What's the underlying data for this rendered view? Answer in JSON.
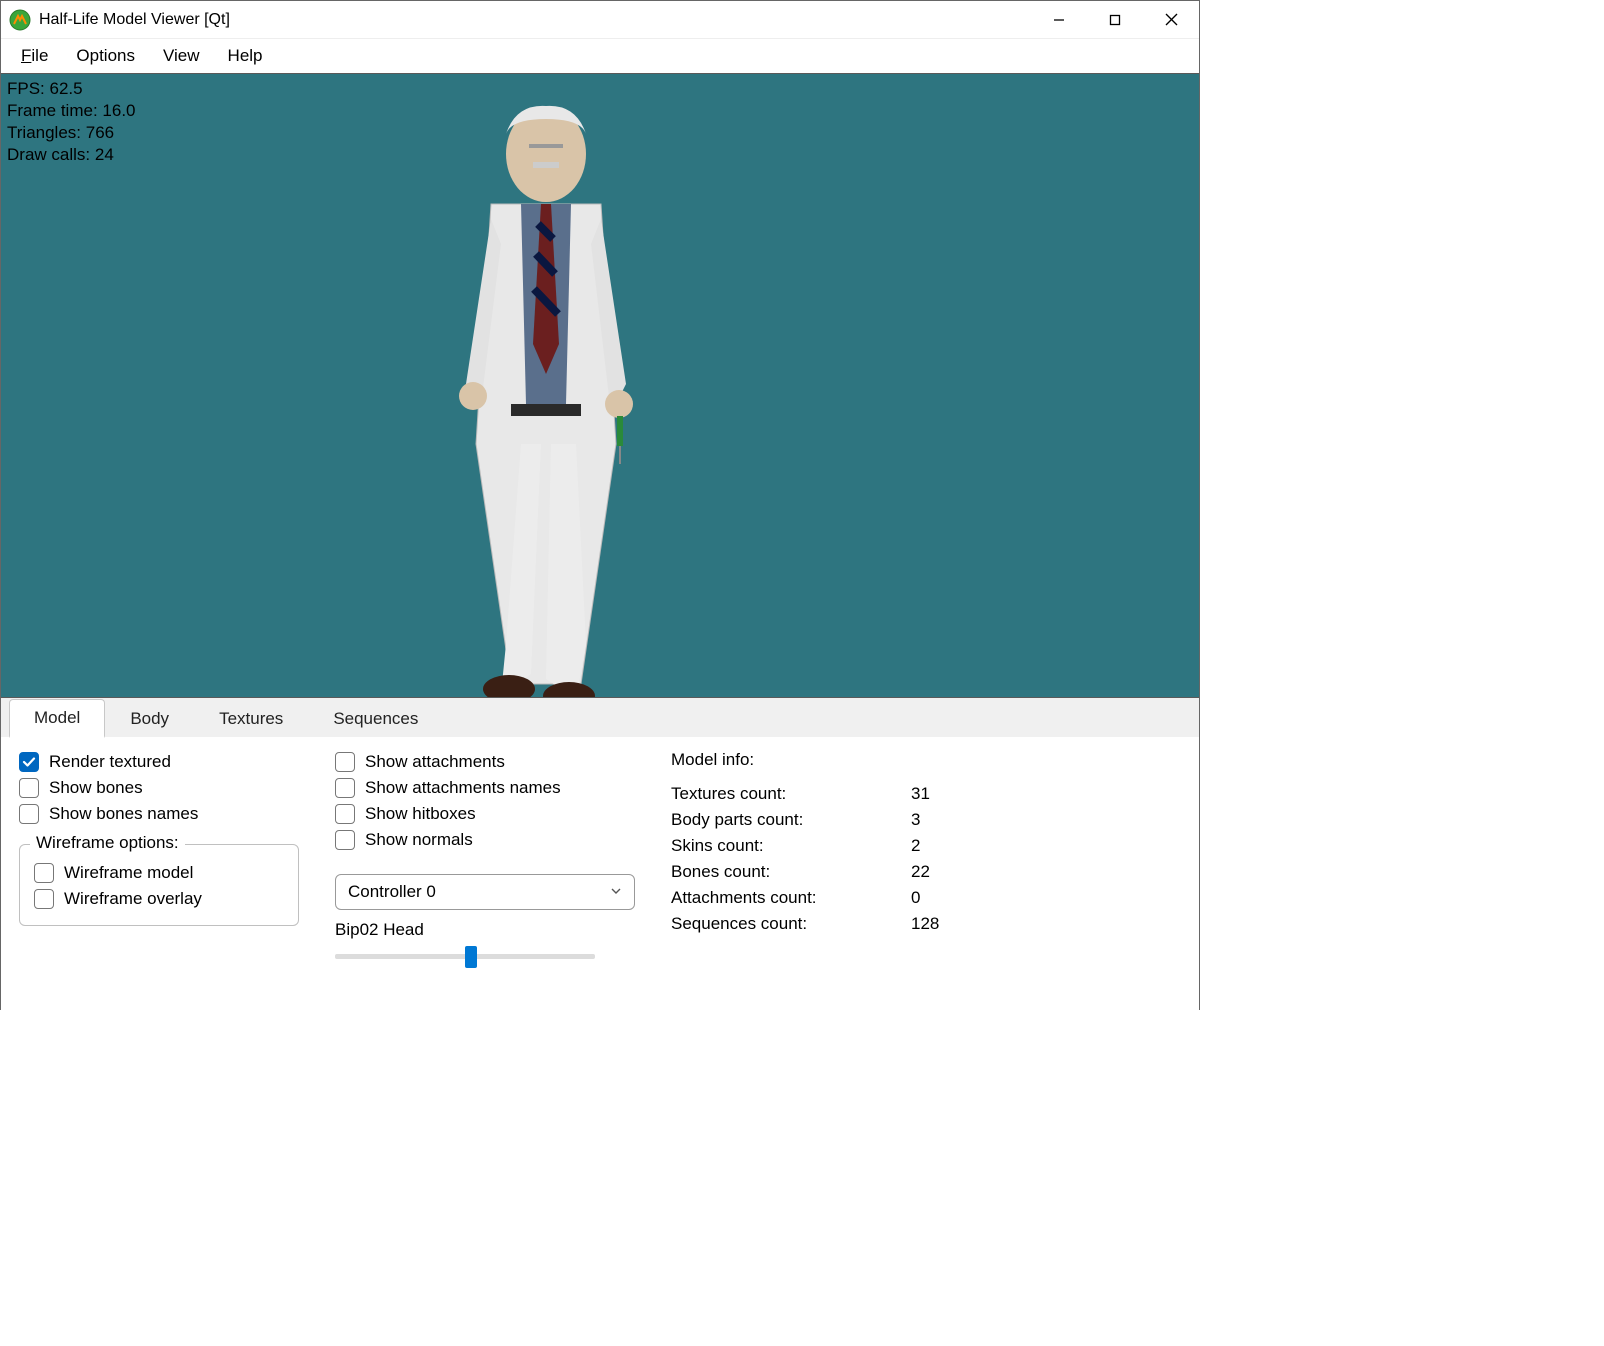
{
  "window": {
    "title": "Half-Life Model Viewer [Qt]"
  },
  "menu": {
    "file": "File",
    "options": "Options",
    "view": "View",
    "help": "Help"
  },
  "stats": {
    "fps_label": "FPS: ",
    "fps": "62.5",
    "frametime_label": "Frame time: ",
    "frametime": "16.0",
    "tris_label": "Triangles: ",
    "tris": "766",
    "drawcalls_label": "Draw calls: ",
    "drawcalls": "24"
  },
  "tabs": {
    "model": "Model",
    "body": "Body",
    "textures": "Textures",
    "sequences": "Sequences"
  },
  "checks": {
    "render_textured": "Render textured",
    "show_bones": "Show bones",
    "show_bones_names": "Show bones names",
    "show_attachments": "Show attachments",
    "show_attachments_names": "Show attachments names",
    "show_hitboxes": "Show hitboxes",
    "show_normals": "Show normals",
    "wireframe_model": "Wireframe model",
    "wireframe_overlay": "Wireframe overlay"
  },
  "group": {
    "wireframe": "Wireframe options:"
  },
  "controller": {
    "selected": "Controller 0",
    "bone": "Bip02 Head",
    "slider_percent": 50
  },
  "info": {
    "legend": "Model info:",
    "textures_k": "Textures count:",
    "textures_v": "31",
    "bodyparts_k": "Body parts count:",
    "bodyparts_v": "3",
    "skins_k": "Skins count:",
    "skins_v": "2",
    "bones_k": "Bones count:",
    "bones_v": "22",
    "attachments_k": "Attachments count:",
    "attachments_v": "0",
    "sequences_k": "Sequences count:",
    "sequences_v": "128"
  },
  "colors": {
    "viewport_bg": "#2e7580",
    "accent": "#0067c0"
  }
}
